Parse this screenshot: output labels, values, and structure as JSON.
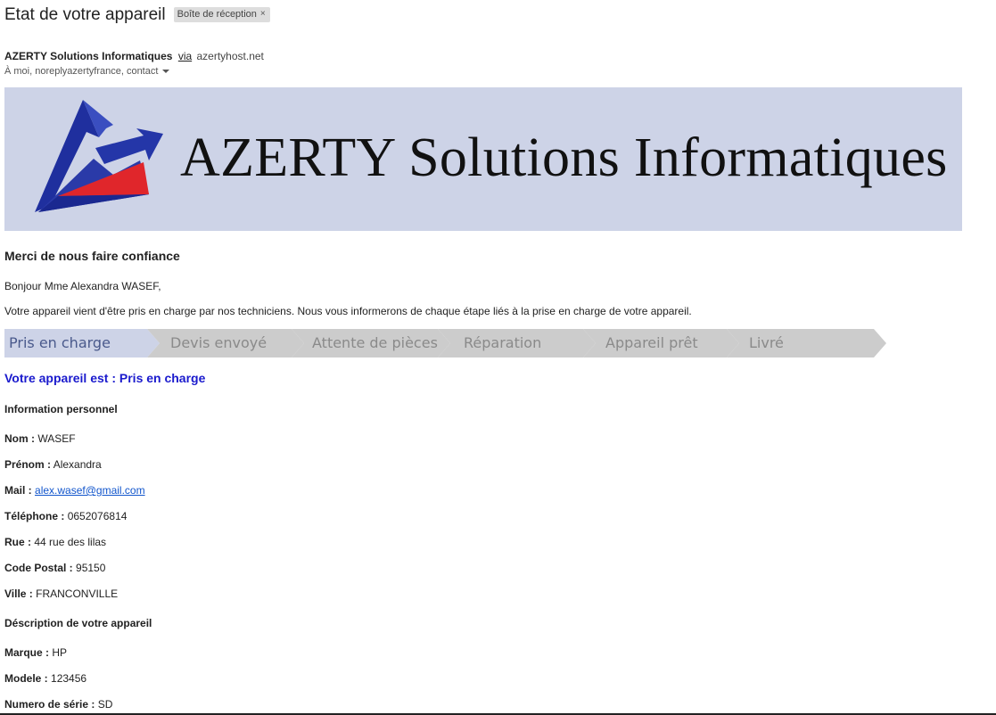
{
  "email": {
    "subject": "Etat de votre appareil",
    "label": "Boîte de réception",
    "label_close": "×",
    "sender_name": "AZERTY Solutions Informatiques",
    "via_word": "via",
    "via_domain": "azertyhost.net",
    "recipients": "À moi, noreplyazertyfrance, contact"
  },
  "banner": {
    "title": "AZERTY Solutions Informatiques",
    "logo_colors": {
      "blue": "#2a3aa8",
      "red": "#e0262b",
      "background": "#cdd3e7"
    }
  },
  "body": {
    "thanks": "Merci de nous faire confiance",
    "greeting": "Bonjour Mme Alexandra WASEF,",
    "intro": "Votre appareil vient d'être pris en charge par nos techniciens. Nous vous informerons de chaque étape liés à la prise en charge de votre appareil.",
    "steps": [
      {
        "label": "Pris en charge",
        "active": true
      },
      {
        "label": "Devis envoyé",
        "active": false
      },
      {
        "label": "Attente de pièces",
        "active": false
      },
      {
        "label": "Réparation",
        "active": false
      },
      {
        "label": "Appareil prêt",
        "active": false
      },
      {
        "label": "Livré",
        "active": false
      }
    ],
    "step_colors": {
      "active": "#cdd3e7",
      "inactive": "#cccccc"
    },
    "status": "Votre appareil est : Pris en charge",
    "personal_heading": "Information personnel",
    "personal": [
      {
        "label": "Nom :",
        "value": "WASEF"
      },
      {
        "label": "Prénom :",
        "value": "Alexandra"
      },
      {
        "label": "Mail :",
        "value": "alex.wasef@gmail.com",
        "link": true
      },
      {
        "label": "Téléphone :",
        "value": "0652076814"
      },
      {
        "label": "Rue :",
        "value": "44 rue des lilas"
      },
      {
        "label": "Code Postal :",
        "value": "95150"
      },
      {
        "label": "Ville :",
        "value": "FRANCONVILLE"
      }
    ],
    "device_heading": "Déscription de votre appareil",
    "device": [
      {
        "label": "Marque :",
        "value": "HP"
      },
      {
        "label": "Modele :",
        "value": "123456"
      },
      {
        "label": "Numero de série :",
        "value": "SD"
      }
    ]
  }
}
